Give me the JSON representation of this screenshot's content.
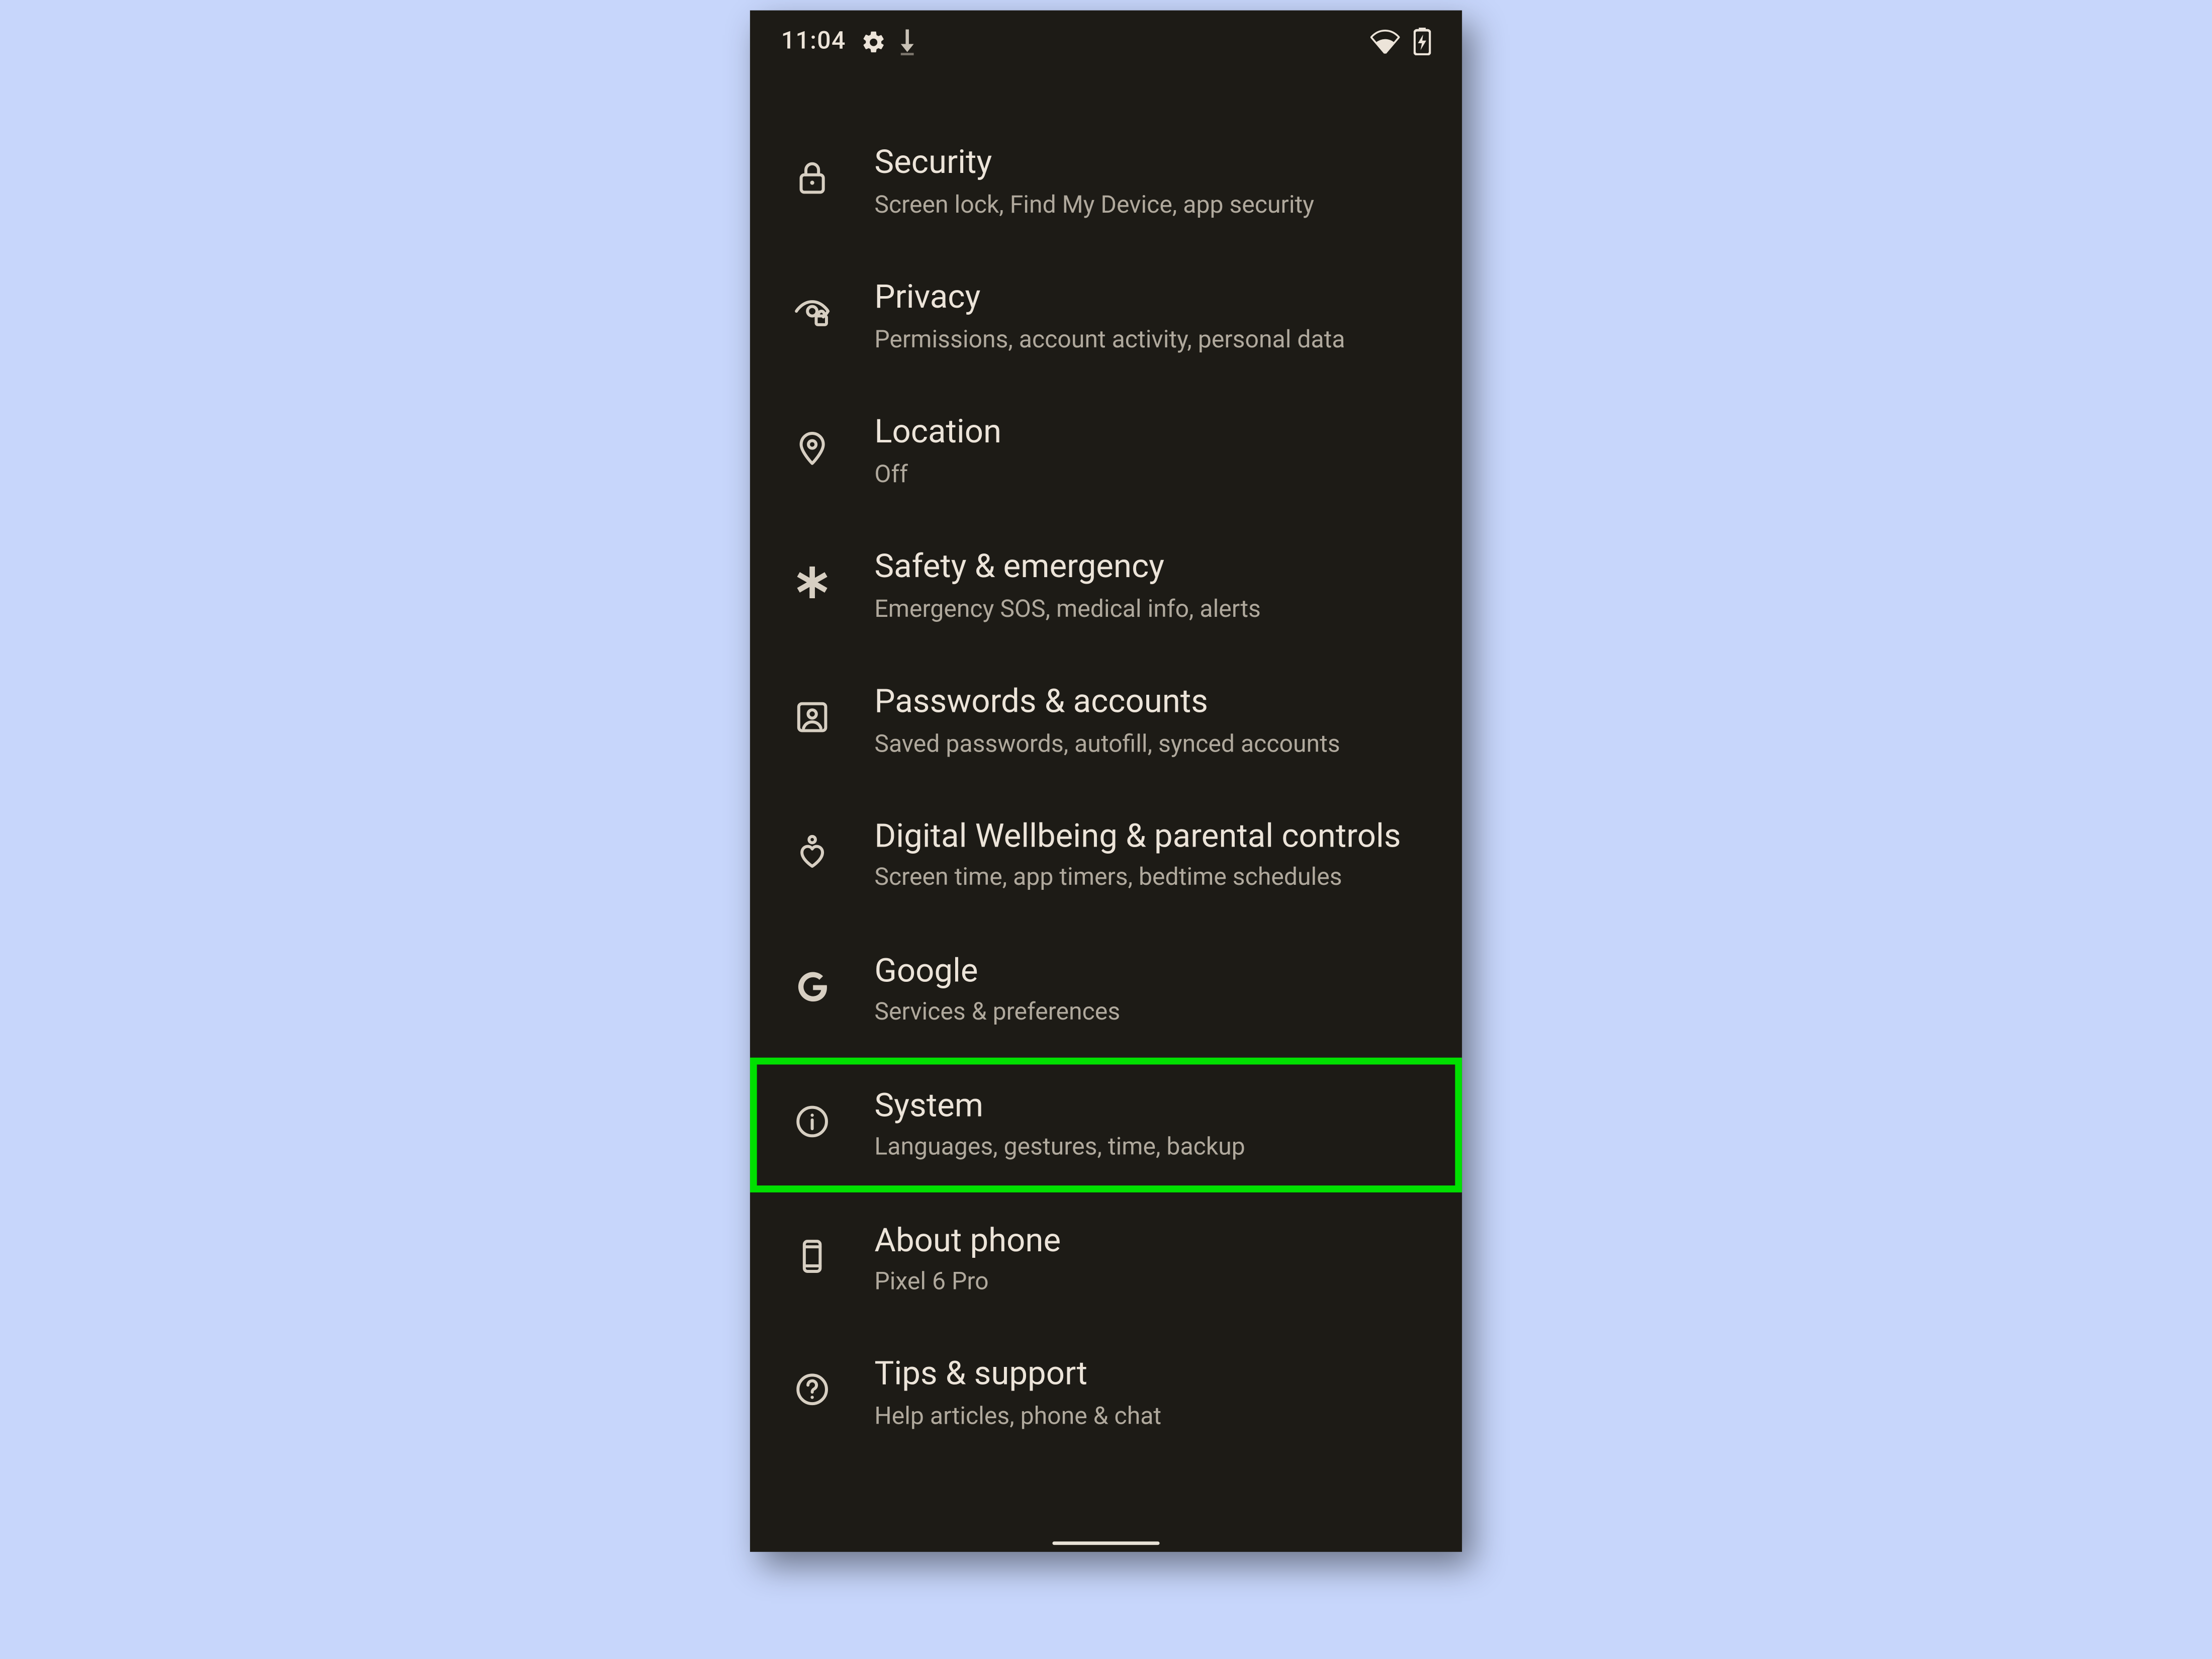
{
  "status": {
    "time": "11:04"
  },
  "highlighted_index": 7,
  "items": [
    {
      "key": "security",
      "title": "Security",
      "sub": "Screen lock, Find My Device, app security"
    },
    {
      "key": "privacy",
      "title": "Privacy",
      "sub": "Permissions, account activity, personal data"
    },
    {
      "key": "location",
      "title": "Location",
      "sub": "Off"
    },
    {
      "key": "safety",
      "title": "Safety & emergency",
      "sub": "Emergency SOS, medical info, alerts"
    },
    {
      "key": "passwords",
      "title": "Passwords & accounts",
      "sub": "Saved passwords, autofill, synced accounts"
    },
    {
      "key": "wellbeing",
      "title": "Digital Wellbeing & parental controls",
      "sub": "Screen time, app timers, bedtime schedules"
    },
    {
      "key": "google",
      "title": "Google",
      "sub": "Services & preferences"
    },
    {
      "key": "system",
      "title": "System",
      "sub": "Languages, gestures, time, backup"
    },
    {
      "key": "about",
      "title": "About phone",
      "sub": "Pixel 6 Pro"
    },
    {
      "key": "tips",
      "title": "Tips & support",
      "sub": "Help articles, phone & chat"
    }
  ]
}
